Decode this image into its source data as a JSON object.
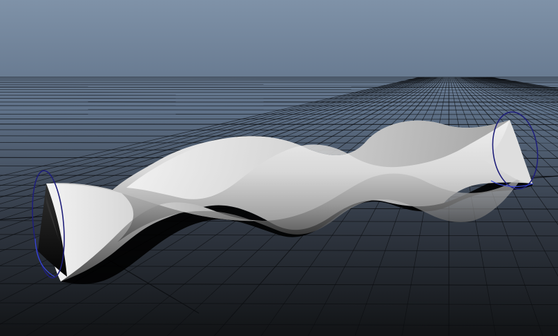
{
  "viewport": {
    "background_top": "#7f92a8",
    "background_bottom": "#111315",
    "grid_color": "#0b0d10",
    "grid_axis_color": "#000000",
    "mesh_fill_light": "#d7d7d7",
    "mesh_fill_mid": "#9d9d9d",
    "mesh_fill_dark": "#595959",
    "mesh_shadow": "#000000",
    "curve_color": "#1f1f7a",
    "curve_highlight": "#3b4bd6"
  }
}
